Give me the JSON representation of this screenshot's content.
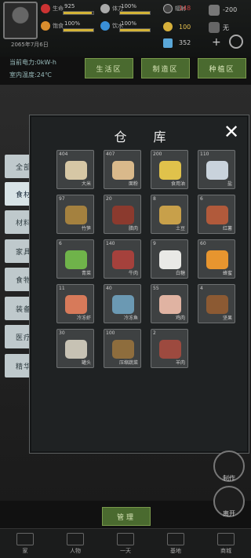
{
  "status": {
    "health_label": "生命",
    "health_value": "925",
    "stamina_label": "体力",
    "stamina_value": "100%",
    "hunger_label": "饱食",
    "hunger_value": "100%",
    "thirst_label": "饮水",
    "thirst_value": "100%",
    "radiation_label": "辐射",
    "radiation_value": "148",
    "temp_value": "-200",
    "coin_value": "100",
    "diamond_value": "352",
    "date": "2065年7月6日",
    "location": "当前电力:0kW-h",
    "indoor_temp": "室内温度:24℃",
    "right_extra": "无"
  },
  "top_buttons": [
    "生活区",
    "制造区",
    "种植区"
  ],
  "tabs": [
    "全部",
    "食材",
    "材料",
    "家具",
    "食物",
    "装备",
    "医疗",
    "精华"
  ],
  "panel": {
    "title": "仓库",
    "close": "✕"
  },
  "items": [
    {
      "count": "404",
      "name": "大米",
      "color": "#d6c7a5"
    },
    {
      "count": "407",
      "name": "面粉",
      "color": "#d9b98b"
    },
    {
      "count": "200",
      "name": "食用油",
      "color": "#e0c24b"
    },
    {
      "count": "110",
      "name": "盐",
      "color": "#c9d3dc"
    },
    {
      "count": "97",
      "name": "竹笋",
      "color": "#a4813f"
    },
    {
      "count": "20",
      "name": "腊肉",
      "color": "#8b3a2e"
    },
    {
      "count": "8",
      "name": "土豆",
      "color": "#c8a04a"
    },
    {
      "count": "6",
      "name": "红薯",
      "color": "#b15a3b"
    },
    {
      "count": "6",
      "name": "青菜",
      "color": "#6fb34a"
    },
    {
      "count": "140",
      "name": "牛肉",
      "color": "#a5413c"
    },
    {
      "count": "9",
      "name": "白糖",
      "color": "#e9e9e6"
    },
    {
      "count": "60",
      "name": "蜂蜜",
      "color": "#e7952f"
    },
    {
      "count": "11",
      "name": "冷冻虾",
      "color": "#d77a5a"
    },
    {
      "count": "40",
      "name": "冷冻鱼",
      "color": "#6b99b3"
    },
    {
      "count": "55",
      "name": "鸡肉",
      "color": "#e0b3a2"
    },
    {
      "count": "4",
      "name": "坚果",
      "color": "#8c5a33"
    },
    {
      "count": "30",
      "name": "罐头",
      "color": "#c7c2b4"
    },
    {
      "count": "100",
      "name": "压缩蔬菜",
      "color": "#8e6d3d"
    },
    {
      "count": "2",
      "name": "羊肉",
      "color": "#9d4a3f"
    }
  ],
  "right_buttons": [
    "制作",
    "离开"
  ],
  "bottom": {
    "manage": "管理",
    "nav": [
      "家",
      "人物",
      "一天",
      "基地",
      "商城"
    ]
  }
}
